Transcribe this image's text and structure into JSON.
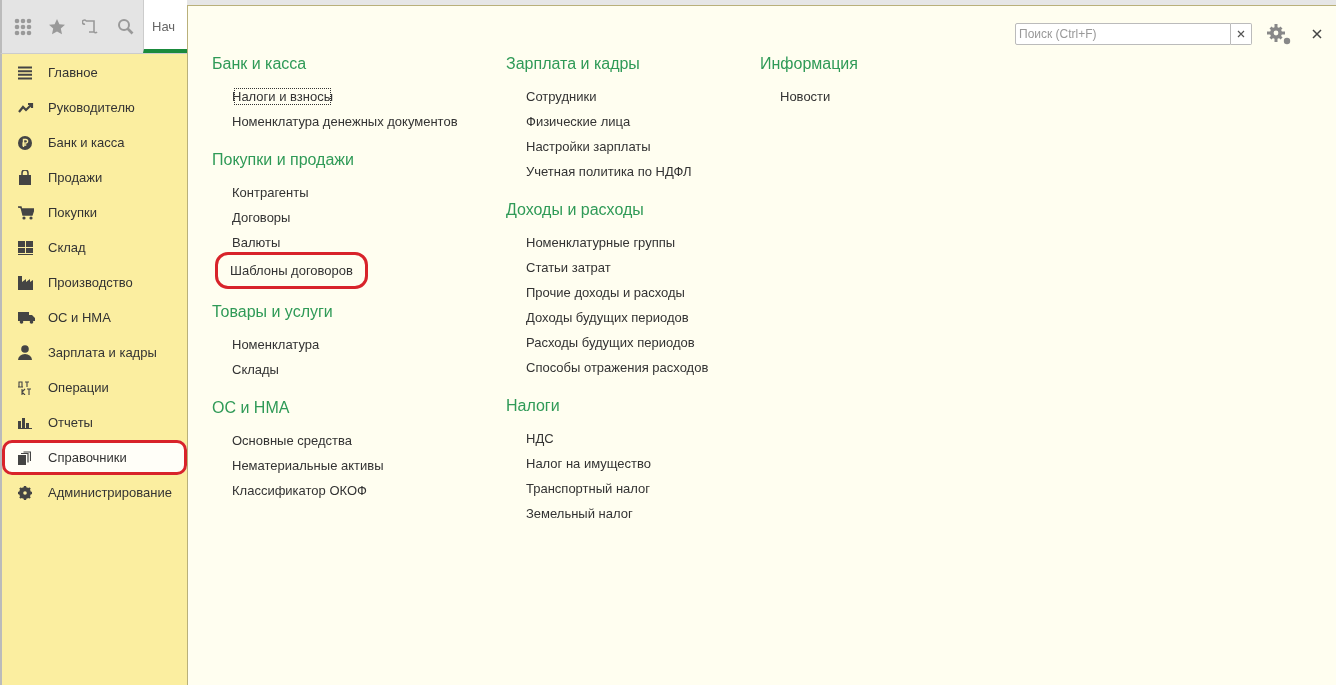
{
  "toolbar": {
    "tab": {
      "label": "Нач",
      "selected": true
    }
  },
  "sidebar": {
    "items": [
      {
        "kind": "lines",
        "label": "Главное",
        "selected": false,
        "highlighted": false
      },
      {
        "kind": "trend",
        "label": "Руководителю",
        "selected": false,
        "highlighted": false
      },
      {
        "kind": "ruble",
        "label": "Банк и касса",
        "selected": false,
        "highlighted": false
      },
      {
        "kind": "bag",
        "label": "Продажи",
        "selected": false,
        "highlighted": false
      },
      {
        "kind": "cart",
        "label": "Покупки",
        "selected": false,
        "highlighted": false
      },
      {
        "kind": "grid",
        "label": "Склад",
        "selected": false,
        "highlighted": false
      },
      {
        "kind": "factory",
        "label": "Производство",
        "selected": false,
        "highlighted": false
      },
      {
        "kind": "truck",
        "label": "ОС и НМА",
        "selected": false,
        "highlighted": false
      },
      {
        "kind": "person",
        "label": "Зарплата и кадры",
        "selected": false,
        "highlighted": false
      },
      {
        "kind": "dtkt",
        "label": "Операции",
        "selected": false,
        "highlighted": false
      },
      {
        "kind": "bars",
        "label": "Отчеты",
        "selected": false,
        "highlighted": false
      },
      {
        "kind": "books",
        "label": "Справочники",
        "selected": true,
        "highlighted": true
      },
      {
        "kind": "gear",
        "label": "Администрирование",
        "selected": false,
        "highlighted": false
      }
    ]
  },
  "panel": {
    "search": {
      "placeholder": "Поиск (Ctrl+F)"
    },
    "columns": [
      [
        {
          "title": "Банк и касса",
          "items": [
            {
              "label": "Налоги и взносы",
              "focused": true,
              "highlighted": false
            },
            {
              "label": "Номенклатура денежных документов",
              "focused": false,
              "highlighted": false
            }
          ]
        },
        {
          "title": "Покупки и продажи",
          "items": [
            {
              "label": "Контрагенты",
              "focused": false,
              "highlighted": false
            },
            {
              "label": "Договоры",
              "focused": false,
              "highlighted": false
            },
            {
              "label": "Валюты",
              "focused": false,
              "highlighted": false
            },
            {
              "label": "Шаблоны договоров",
              "focused": false,
              "highlighted": true
            }
          ]
        },
        {
          "title": "Товары и услуги",
          "items": [
            {
              "label": "Номенклатура",
              "focused": false,
              "highlighted": false
            },
            {
              "label": "Склады",
              "focused": false,
              "highlighted": false
            }
          ]
        },
        {
          "title": "ОС и НМА",
          "items": [
            {
              "label": "Основные средства",
              "focused": false,
              "highlighted": false
            },
            {
              "label": "Нематериальные активы",
              "focused": false,
              "highlighted": false
            },
            {
              "label": "Классификатор ОКОФ",
              "focused": false,
              "highlighted": false
            }
          ]
        }
      ],
      [
        {
          "title": "Зарплата и кадры",
          "items": [
            {
              "label": "Сотрудники",
              "focused": false,
              "highlighted": false
            },
            {
              "label": "Физические лица",
              "focused": false,
              "highlighted": false
            },
            {
              "label": "Настройки зарплаты",
              "focused": false,
              "highlighted": false
            },
            {
              "label": "Учетная политика по НДФЛ",
              "focused": false,
              "highlighted": false
            }
          ]
        },
        {
          "title": "Доходы и расходы",
          "items": [
            {
              "label": "Номенклатурные группы",
              "focused": false,
              "highlighted": false
            },
            {
              "label": "Статьи затрат",
              "focused": false,
              "highlighted": false
            },
            {
              "label": "Прочие доходы и расходы",
              "focused": false,
              "highlighted": false
            },
            {
              "label": "Доходы будущих периодов",
              "focused": false,
              "highlighted": false
            },
            {
              "label": "Расходы будущих периодов",
              "focused": false,
              "highlighted": false
            },
            {
              "label": "Способы отражения расходов",
              "focused": false,
              "highlighted": false
            }
          ]
        },
        {
          "title": "Налоги",
          "items": [
            {
              "label": "НДС",
              "focused": false,
              "highlighted": false
            },
            {
              "label": "Налог на имущество",
              "focused": false,
              "highlighted": false
            },
            {
              "label": "Транспортный налог",
              "focused": false,
              "highlighted": false
            },
            {
              "label": "Земельный налог",
              "focused": false,
              "highlighted": false
            }
          ]
        }
      ],
      [
        {
          "title": "Информация",
          "items": [
            {
              "label": "Новости",
              "focused": false,
              "highlighted": false
            }
          ]
        }
      ]
    ]
  }
}
